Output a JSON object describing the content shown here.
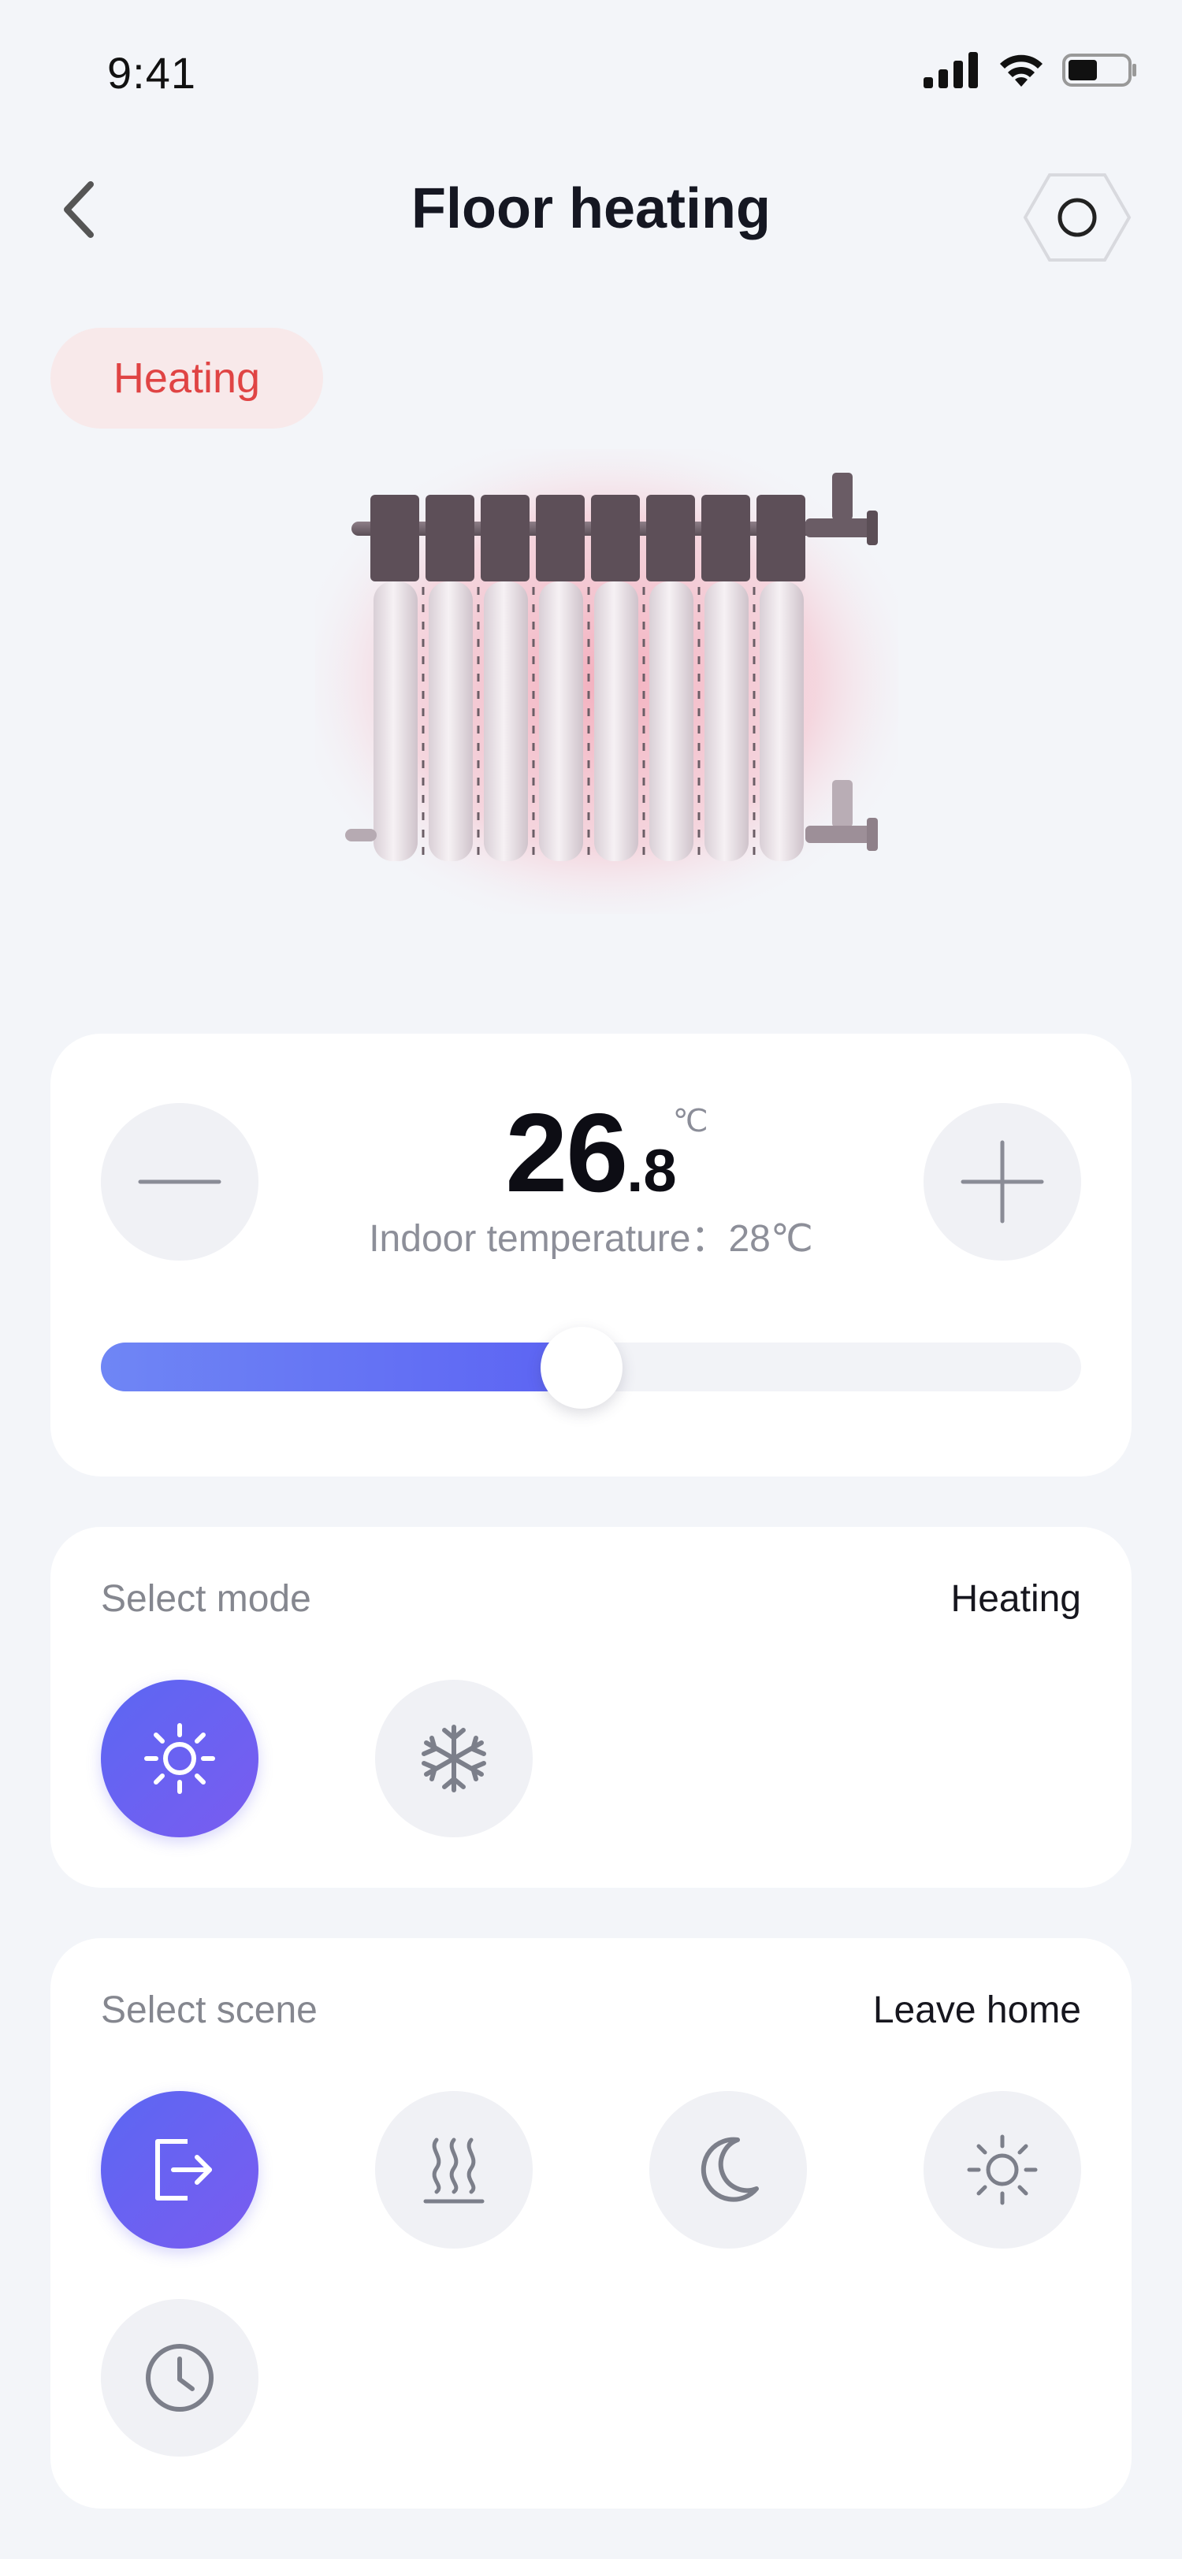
{
  "status_bar": {
    "time": "9:41"
  },
  "nav": {
    "title": "Floor heating"
  },
  "status_pill": {
    "label": "Heating"
  },
  "temperature": {
    "value_int": "26",
    "value_dec": ".8",
    "unit": "℃",
    "indoor": "Indoor temperature：28℃",
    "slider_fraction": 0.49
  },
  "mode": {
    "label": "Select mode",
    "current": "Heating",
    "options": [
      {
        "icon": "sun-icon",
        "active": true
      },
      {
        "icon": "snowflake-icon",
        "active": false
      }
    ]
  },
  "scene": {
    "label": "Select scene",
    "current": "Leave home",
    "options": [
      {
        "icon": "leave-home-icon",
        "active": true
      },
      {
        "icon": "heat-waves-icon",
        "active": false
      },
      {
        "icon": "moon-icon",
        "active": false
      },
      {
        "icon": "sun-icon",
        "active": false
      },
      {
        "icon": "clock-icon",
        "active": false
      }
    ]
  },
  "colors": {
    "accent": "#5c63f3",
    "heating_text": "#e04444",
    "heating_pill_bg": "#f8e9ea",
    "background": "#f3f5f9"
  }
}
